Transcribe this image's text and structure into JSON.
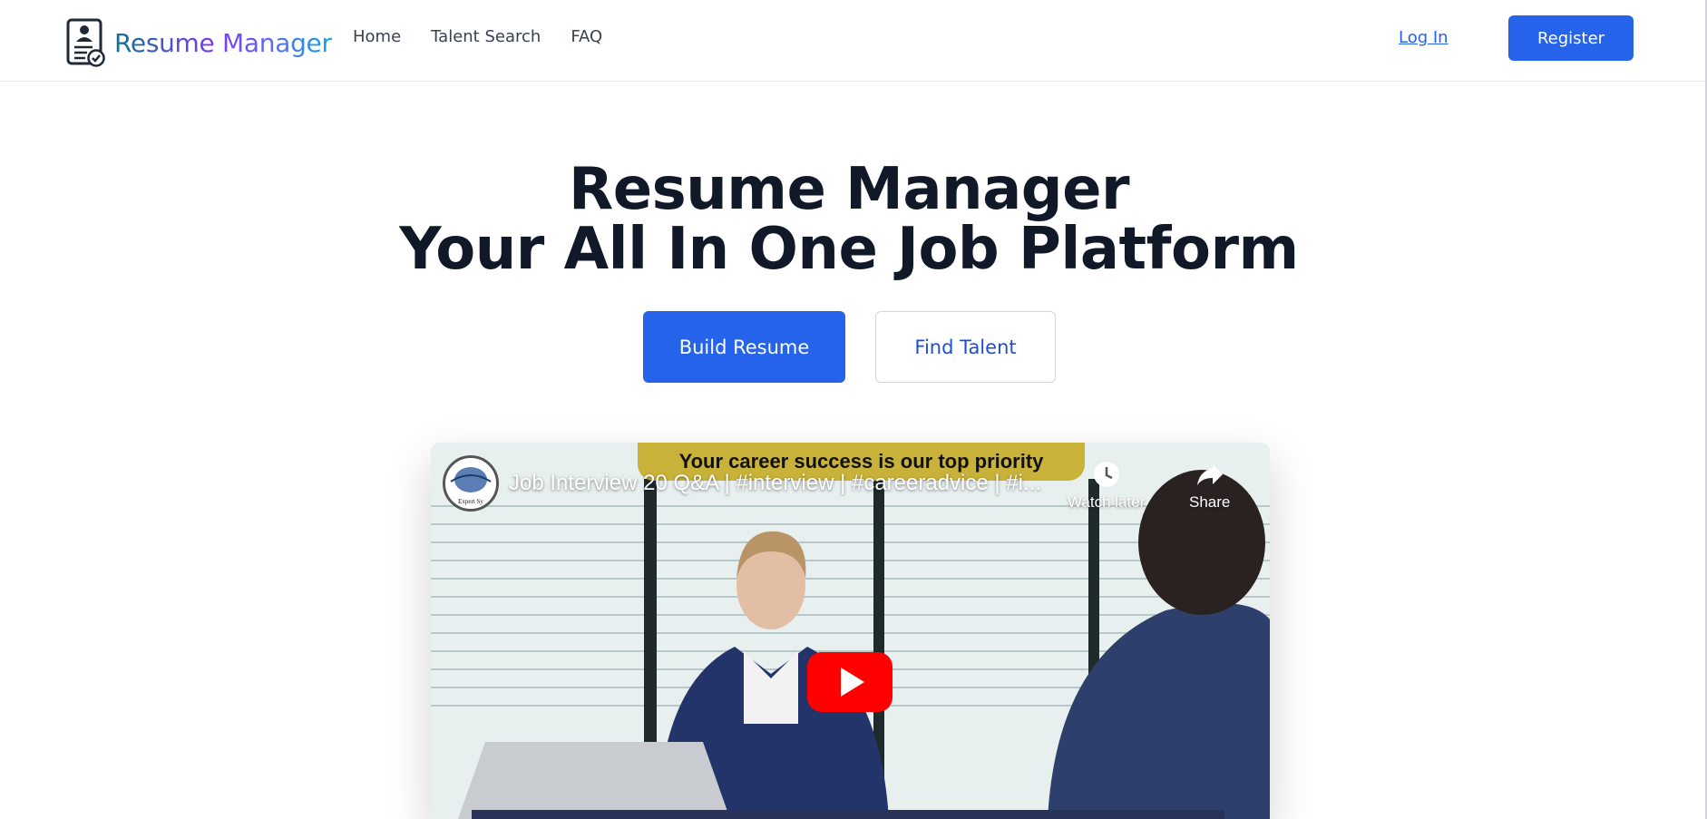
{
  "header": {
    "logo_text": "Resume Manager",
    "nav": [
      "Home",
      "Talent Search",
      "FAQ"
    ],
    "login_label": "Log In",
    "register_label": "Register"
  },
  "hero": {
    "title_line1": "Resume Manager",
    "title_line2": "Your All In One Job Platform",
    "primary_button": "Build Resume",
    "secondary_button": "Find Talent"
  },
  "video": {
    "banner_text": "Your career success is our top priority",
    "title": "Job Interview 20 Q&A | #interview | #careeradvice | #i...",
    "watch_later_label": "Watch later",
    "share_label": "Share",
    "channel_avatar_text": "Expert Sy"
  },
  "colors": {
    "accent": "#2563eb",
    "text": "#111827",
    "play": "#ff0000"
  }
}
